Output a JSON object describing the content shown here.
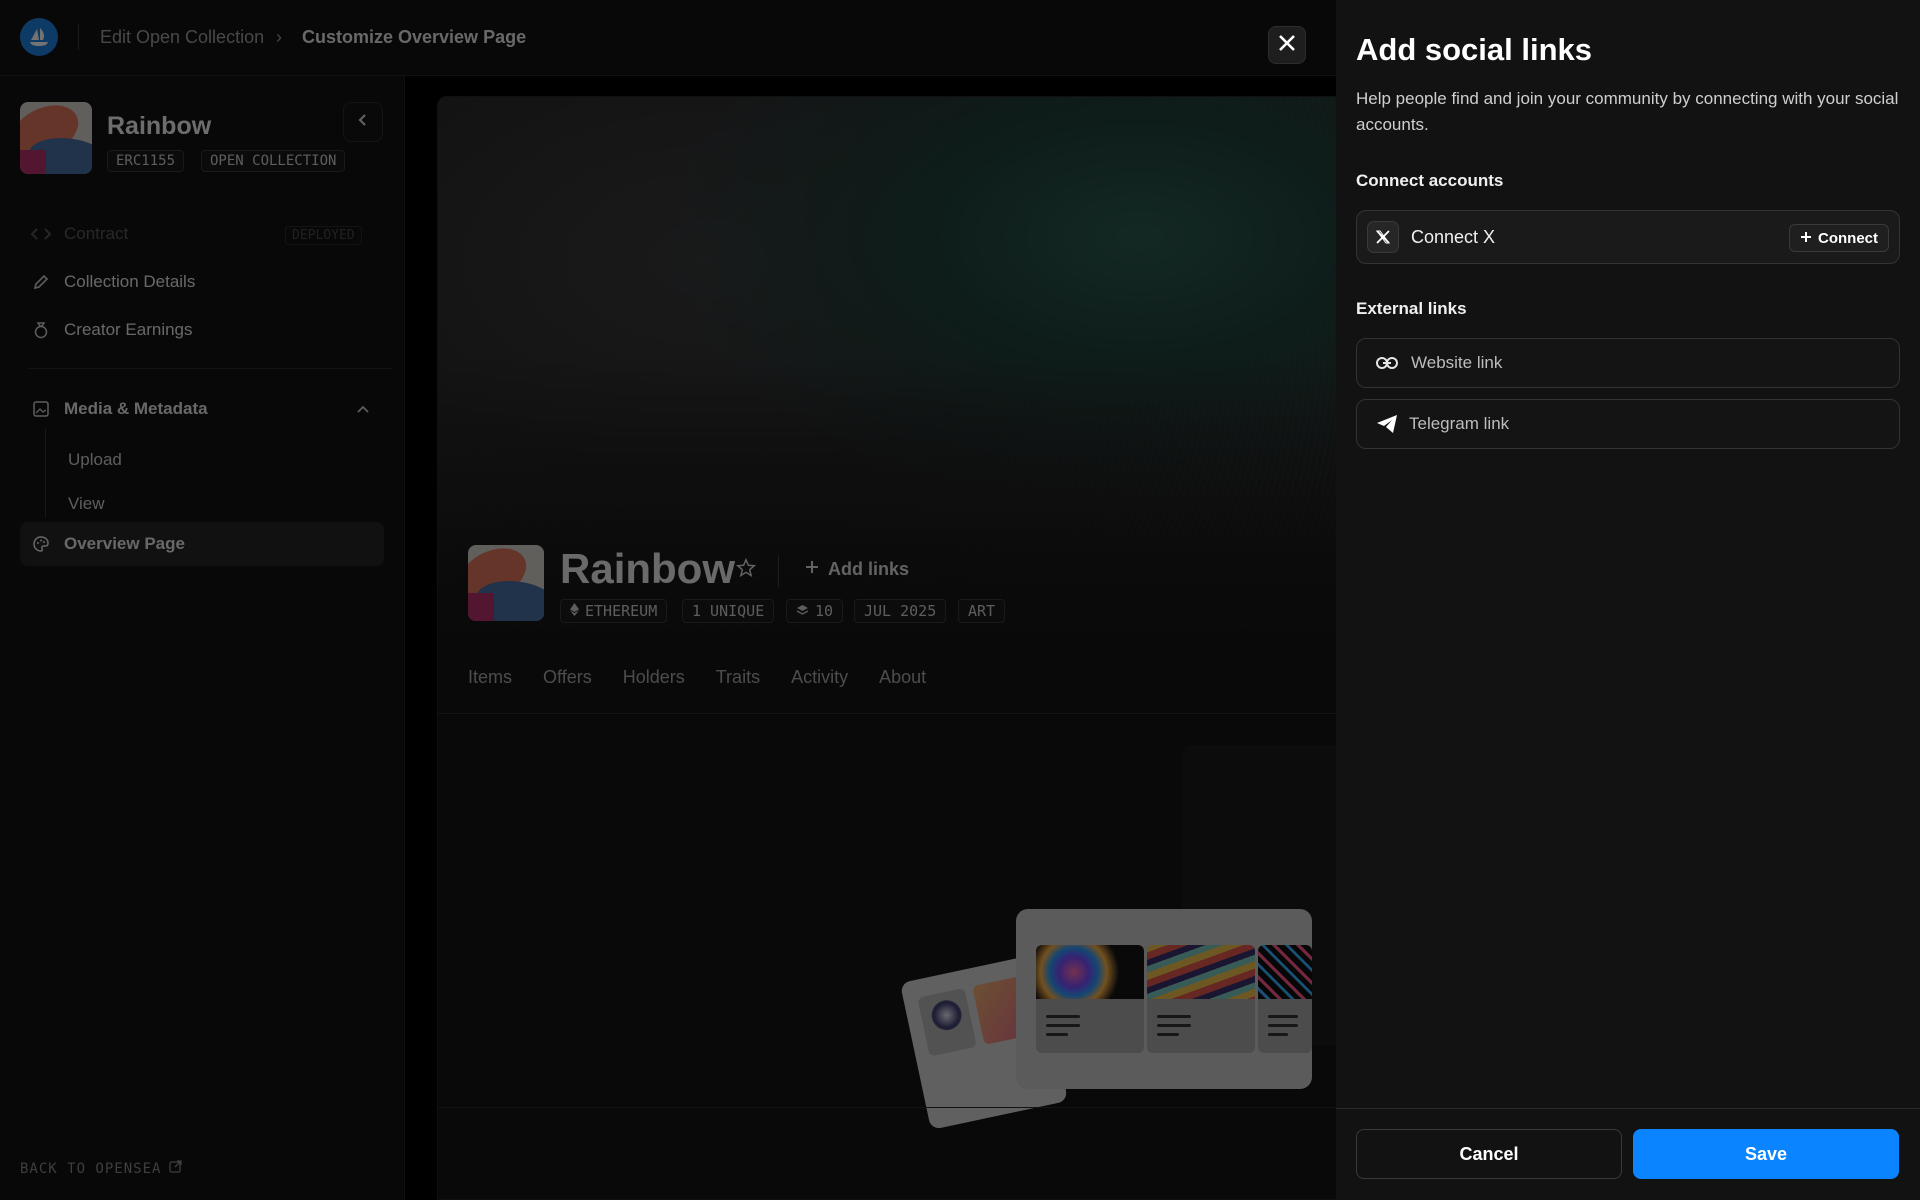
{
  "topbar": {
    "breadcrumb_parent": "Edit Open Collection",
    "breadcrumb_separator": "›",
    "breadcrumb_current": "Customize Overview Page"
  },
  "sidebar": {
    "collection_name": "Rainbow",
    "tags": [
      "ERC1155",
      "OPEN COLLECTION"
    ],
    "nav": {
      "contract": "Contract",
      "contract_status": "DEPLOYED",
      "collection_details": "Collection Details",
      "creator_earnings": "Creator Earnings",
      "media_metadata": "Media & Metadata",
      "upload": "Upload",
      "view": "View",
      "overview_page": "Overview Page"
    },
    "back_link": "BACK TO OPENSEA"
  },
  "preview": {
    "title": "Rainbow",
    "add_links": "Add links",
    "tags": {
      "chain": "ETHEREUM",
      "unique": "1 UNIQUE",
      "supply": "10",
      "date": "JUL 2025",
      "category": "ART"
    },
    "tabs": [
      "Items",
      "Offers",
      "Holders",
      "Traits",
      "Activity",
      "About"
    ]
  },
  "drawer": {
    "title": "Add social links",
    "description": "Help people find and join your community by connecting with your social accounts.",
    "connect_section": "Connect accounts",
    "connect_x_label": "Connect X",
    "connect_button": "Connect",
    "external_section": "External links",
    "website_placeholder": "Website link",
    "telegram_placeholder": "Telegram link",
    "cancel": "Cancel",
    "save": "Save"
  },
  "colors": {
    "accent": "#0a84ff",
    "opensea_blue": "#2081e2",
    "background": "#121212"
  }
}
